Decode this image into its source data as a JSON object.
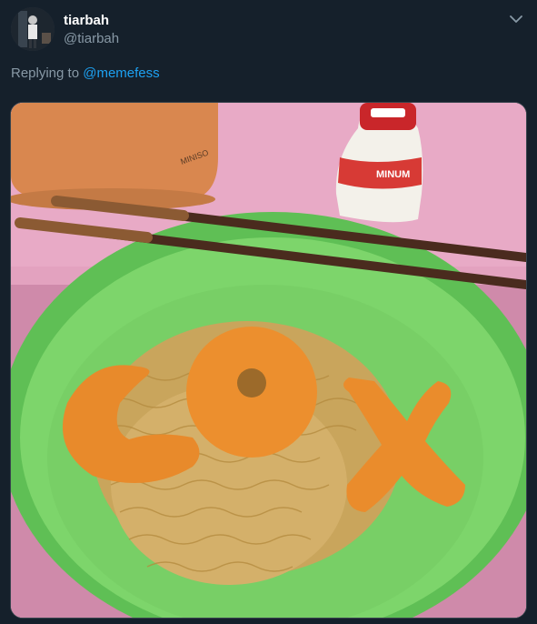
{
  "tweet": {
    "display_name": "tiarbah",
    "handle": "@tiarbah",
    "reply_prefix": "Replying to",
    "reply_to": "@memefess"
  },
  "media": {
    "alt": "Plate of fried instant noodles with nuggets shaped into letters, chopsticks, a cup and a yogurt drink bottle",
    "kettle_brand": "MINISO",
    "bottle_text": "MINUM"
  },
  "icons": {
    "menu": "chevron-down-icon"
  },
  "colors": {
    "background": "#15202b",
    "primary_text": "#ffffff",
    "secondary_text": "#8899a6",
    "link": "#1da1f2"
  }
}
